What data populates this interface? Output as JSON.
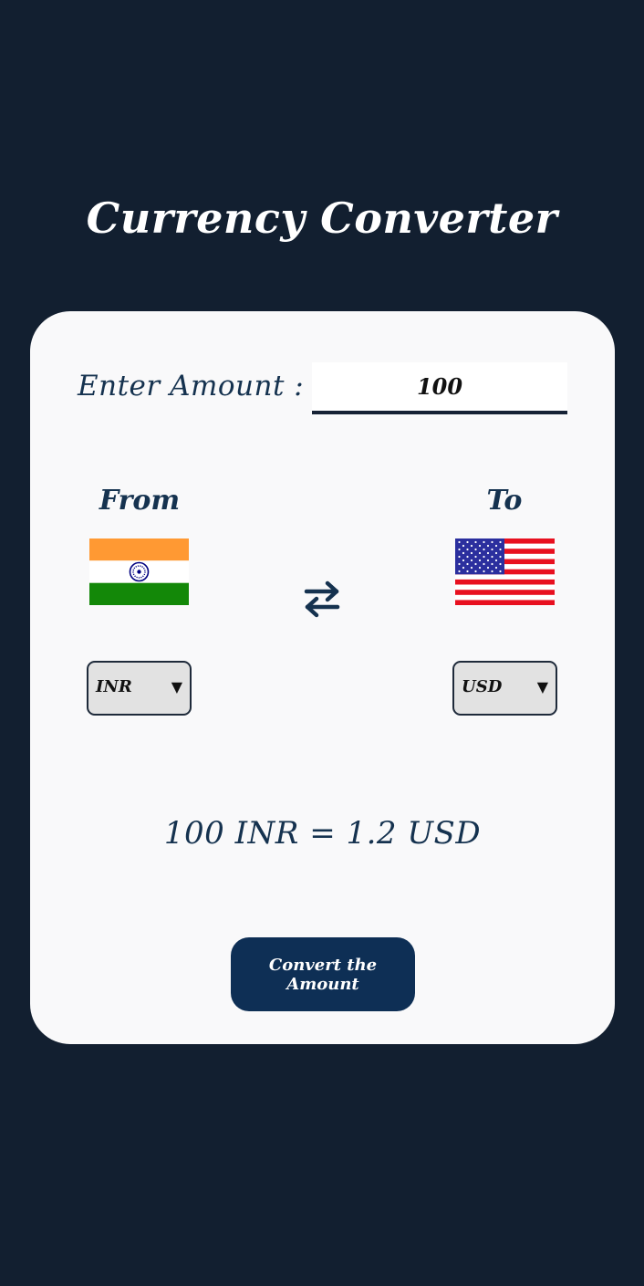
{
  "app": {
    "title": "Currency Converter"
  },
  "amount": {
    "label": "Enter Amount :",
    "value": "100"
  },
  "from": {
    "label": "From",
    "currency": "INR",
    "flag_icon": "india-flag-icon"
  },
  "to": {
    "label": "To",
    "currency": "USD",
    "flag_icon": "usa-flag-icon"
  },
  "swap": {
    "icon": "swap-arrows-icon"
  },
  "dropdown": {
    "arrow": "▼"
  },
  "result": {
    "text": "100 INR = 1.2 USD"
  },
  "convert_button": {
    "label": "Convert the Amount"
  },
  "colors": {
    "background": "#121f30",
    "card": "#f9f9fa",
    "accent_text": "#15324f",
    "button": "#0e2f55"
  }
}
